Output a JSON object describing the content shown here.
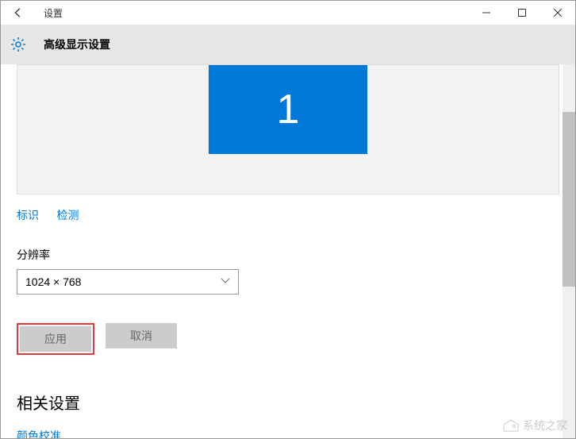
{
  "window": {
    "title": "设置"
  },
  "header": {
    "title": "高级显示设置"
  },
  "monitor": {
    "number": "1"
  },
  "links": {
    "identify": "标识",
    "detect": "检测"
  },
  "resolution": {
    "label": "分辨率",
    "value": "1024 × 768"
  },
  "buttons": {
    "apply": "应用",
    "cancel": "取消"
  },
  "related": {
    "heading": "相关设置",
    "color_calibration": "颜色校准"
  },
  "watermark": {
    "text": "系统之家"
  }
}
